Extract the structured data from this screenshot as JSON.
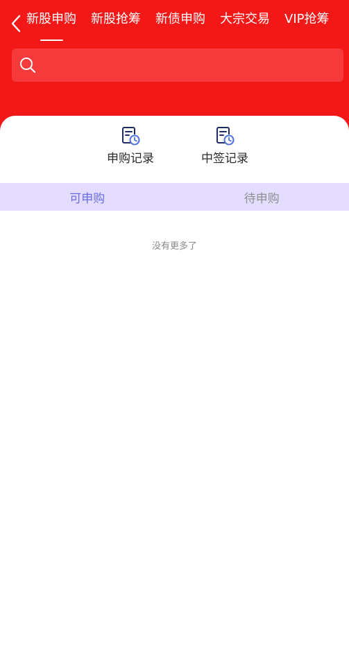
{
  "header": {
    "tabs": [
      {
        "label": "新股申购",
        "active": true
      },
      {
        "label": "新股抢筹",
        "active": false
      },
      {
        "label": "新债申购",
        "active": false
      },
      {
        "label": "大宗交易",
        "active": false
      },
      {
        "label": "VIP抢筹",
        "active": false
      }
    ],
    "back_icon": "chevron-left-icon",
    "search": {
      "value": "",
      "placeholder": "",
      "icon": "search-icon"
    }
  },
  "quick_links": [
    {
      "label": "申购记录",
      "icon": "record-clock-icon"
    },
    {
      "label": "中签记录",
      "icon": "record-clock-icon"
    }
  ],
  "subtabs": [
    {
      "label": "可申购",
      "active": true
    },
    {
      "label": "待申购",
      "active": false
    }
  ],
  "list": {
    "empty_text": "没有更多了"
  },
  "colors": {
    "header_bg": "#f31818",
    "subtab_bg": "#e4ddff",
    "accent": "#6a6ee0",
    "icon_dark": "#1e2a66",
    "icon_light": "#4a6ee0"
  }
}
